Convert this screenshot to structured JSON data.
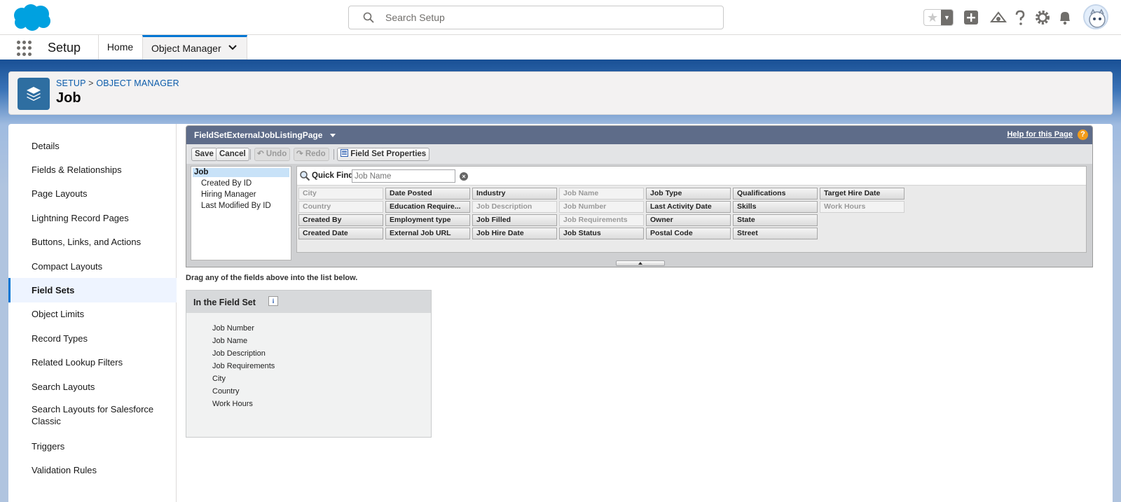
{
  "header": {
    "search_placeholder": "Search Setup",
    "icons": [
      "favorites-star-icon",
      "add-icon",
      "trailhead-icon",
      "help-icon",
      "gear-icon",
      "bell-icon",
      "avatar"
    ]
  },
  "nav": {
    "app_name": "Setup",
    "tabs": [
      {
        "label": "Home"
      },
      {
        "label": "Object Manager"
      }
    ]
  },
  "page": {
    "breadcrumb": {
      "setup": "SETUP",
      "separator": ">",
      "object_manager": "OBJECT MANAGER"
    },
    "title": "Job"
  },
  "sidebar": {
    "items": [
      {
        "label": "Details"
      },
      {
        "label": "Fields & Relationships"
      },
      {
        "label": "Page Layouts"
      },
      {
        "label": "Lightning Record Pages"
      },
      {
        "label": "Buttons, Links, and Actions"
      },
      {
        "label": "Compact Layouts"
      },
      {
        "label": "Field Sets",
        "active": true
      },
      {
        "label": "Object Limits"
      },
      {
        "label": "Record Types"
      },
      {
        "label": "Related Lookup Filters"
      },
      {
        "label": "Search Layouts"
      },
      {
        "label": "Search Layouts for Salesforce Classic"
      },
      {
        "label": "Triggers"
      },
      {
        "label": "Validation Rules"
      }
    ]
  },
  "editor": {
    "title": "FieldSetExternalJobListingPage",
    "help_link": "Help for this Page",
    "toolbar": {
      "save": "Save",
      "cancel": "Cancel",
      "undo": "Undo",
      "redo": "Redo",
      "properties": "Field Set Properties"
    },
    "tree": {
      "root": "Job",
      "children": [
        "Created By ID",
        "Hiring Manager",
        "Last Modified By ID"
      ]
    },
    "quick_find": {
      "label": "Quick Find",
      "value": "Job Name"
    },
    "fields": [
      [
        {
          "label": "City",
          "used": true
        },
        {
          "label": "Date Posted"
        },
        {
          "label": "Industry"
        },
        {
          "label": "Job Name",
          "used": true
        },
        {
          "label": "Job Type"
        },
        {
          "label": "Qualifications"
        },
        {
          "label": "Target Hire Date"
        }
      ],
      [
        {
          "label": "Country",
          "used": true
        },
        {
          "label": "Education Require..."
        },
        {
          "label": "Job Description",
          "used": true
        },
        {
          "label": "Job Number",
          "used": true
        },
        {
          "label": "Last Activity Date"
        },
        {
          "label": "Skills"
        },
        {
          "label": "Work Hours",
          "used": true
        }
      ],
      [
        {
          "label": "Created By"
        },
        {
          "label": "Employment type"
        },
        {
          "label": "Job Filled"
        },
        {
          "label": "Job Requirements",
          "used": true
        },
        {
          "label": "Owner"
        },
        {
          "label": "State"
        }
      ],
      [
        {
          "label": "Created Date"
        },
        {
          "label": "External Job URL"
        },
        {
          "label": "Job Hire Date"
        },
        {
          "label": "Job Status"
        },
        {
          "label": "Postal Code"
        },
        {
          "label": "Street"
        }
      ]
    ]
  },
  "instructions": "Drag any of the fields above into the list below.",
  "field_set": {
    "title": "In the Field Set",
    "items": [
      "Job Number",
      "Job Name",
      "Job Description",
      "Job Requirements",
      "City",
      "Country",
      "Work Hours"
    ]
  },
  "colors": {
    "brand": "#0176d3",
    "editor_bar": "#5e6c89",
    "band": "#1b5297"
  }
}
